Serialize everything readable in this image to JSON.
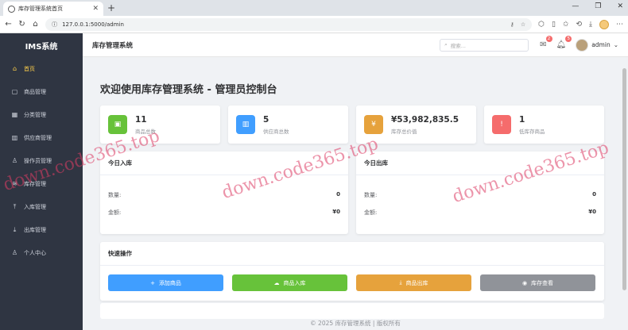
{
  "browser": {
    "tab_title": "库存管理系统首页",
    "url": "127.0.0.1:5000/admin"
  },
  "sidebar": {
    "brand": "IMS系统",
    "items": [
      {
        "label": "首页",
        "icon": "home-icon",
        "active": true
      },
      {
        "label": "商品管理",
        "icon": "box-icon"
      },
      {
        "label": "分类管理",
        "icon": "grid-icon"
      },
      {
        "label": "供应商管理",
        "icon": "building-icon"
      },
      {
        "label": "操作员管理",
        "icon": "user-icon"
      },
      {
        "label": "库存管理",
        "icon": "database-icon"
      },
      {
        "label": "入库管理",
        "icon": "inbox-in-icon"
      },
      {
        "label": "出库管理",
        "icon": "download-icon"
      },
      {
        "label": "个人中心",
        "icon": "user-icon"
      }
    ]
  },
  "header": {
    "title": "库存管理系统",
    "search_placeholder": "搜索...",
    "mail_count": "2",
    "bell_count": "5",
    "user": "admin"
  },
  "welcome": "欢迎使用库存管理系统 - 管理员控制台",
  "stats": [
    {
      "value": "11",
      "label": "商品总数",
      "color": "#67c23a"
    },
    {
      "value": "5",
      "label": "供应商总数",
      "color": "#409eff"
    },
    {
      "value": "¥53,982,835.5",
      "label": "库存总价值",
      "color": "#e6a23c"
    },
    {
      "value": "1",
      "label": "低库存商品",
      "color": "#f56c6c"
    }
  ],
  "today_in": {
    "title": "今日入库",
    "qty_label": "数量:",
    "qty": "0",
    "amount_label": "金额:",
    "amount": "¥0"
  },
  "today_out": {
    "title": "今日出库",
    "qty_label": "数量:",
    "qty": "0",
    "amount_label": "金额:",
    "amount": "¥0"
  },
  "quick": {
    "title": "快速操作",
    "buttons": [
      {
        "label": "添加商品",
        "color": "#409eff"
      },
      {
        "label": "商品入库",
        "color": "#67c23a"
      },
      {
        "label": "商品出库",
        "color": "#e6a23c"
      },
      {
        "label": "库存查看",
        "color": "#909399"
      }
    ]
  },
  "footer": "© 2025 库存管理系统 | 版权所有",
  "watermark": "down.code365.top"
}
